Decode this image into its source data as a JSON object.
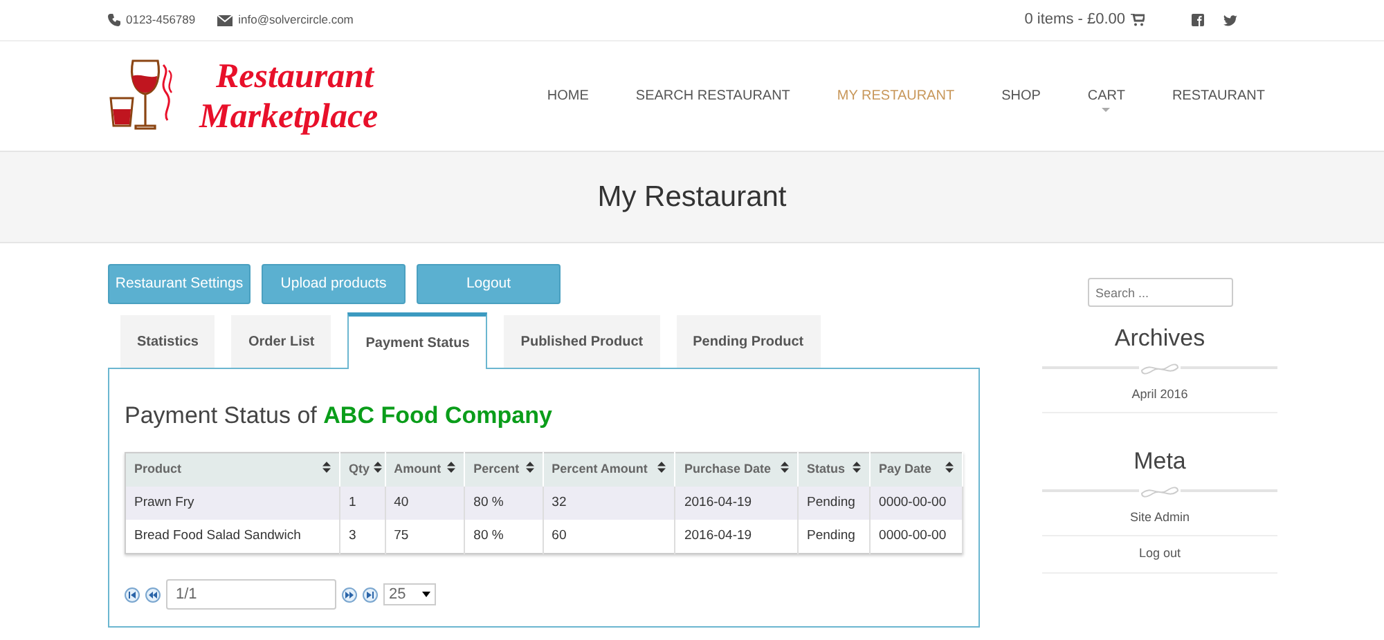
{
  "topbar": {
    "phone": "0123-456789",
    "email": "info@solvercircle.com",
    "cart": "0 items - £0.00"
  },
  "logo": {
    "line1": "Restaurant",
    "line2": "Marketplace"
  },
  "nav": [
    {
      "label": "HOME",
      "selected": false,
      "dropdown": false
    },
    {
      "label": "SEARCH RESTAURANT",
      "selected": false,
      "dropdown": false
    },
    {
      "label": "MY RESTAURANT",
      "selected": true,
      "dropdown": false
    },
    {
      "label": "SHOP",
      "selected": false,
      "dropdown": false
    },
    {
      "label": "CART",
      "selected": false,
      "dropdown": true
    },
    {
      "label": "RESTAURANT",
      "selected": false,
      "dropdown": false
    }
  ],
  "page_title": "My Restaurant",
  "buttons": [
    "Restaurant Settings",
    "Upload products",
    "Logout"
  ],
  "tabs": [
    {
      "label": "Statistics",
      "selected": false
    },
    {
      "label": "Order List",
      "selected": false
    },
    {
      "label": "Payment Status",
      "selected": true
    },
    {
      "label": "Published Product",
      "selected": false
    },
    {
      "label": "Pending Product",
      "selected": false
    }
  ],
  "panel_heading": "Payment Status of **ABC Food Company**",
  "table": {
    "columns": [
      "Product",
      "Qty",
      "Amount",
      "Percent",
      "Percent Amount",
      "Purchase Date",
      "Status",
      "Pay Date"
    ],
    "rows": [
      [
        "Prawn Fry",
        "1",
        "40",
        "80 %",
        "32",
        "2016-04-19",
        "Pending",
        "0000-00-00"
      ],
      [
        "Bread Food Salad Sandwich",
        "3",
        "75",
        "80 %",
        "60",
        "2016-04-19",
        "Pending",
        "0000-00-00"
      ]
    ]
  },
  "pager": {
    "page": "1/1",
    "page_size": "25"
  },
  "sidebar": {
    "search": {
      "placeholder": "Search ..."
    },
    "widgets": [
      {
        "title": "Archives",
        "items": [
          "April 2016"
        ]
      },
      {
        "title": "Meta",
        "items": [
          "Site Admin",
          "Log out"
        ]
      }
    ]
  }
}
